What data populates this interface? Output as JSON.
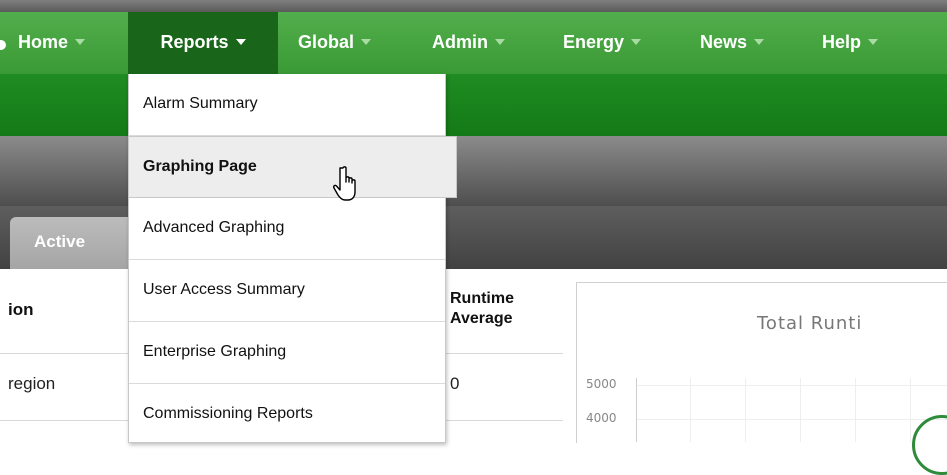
{
  "nav": {
    "items": [
      {
        "label": "Home"
      },
      {
        "label": "Reports"
      },
      {
        "label": "Global"
      },
      {
        "label": "Admin"
      },
      {
        "label": "Energy"
      },
      {
        "label": "News"
      },
      {
        "label": "Help"
      }
    ],
    "active": "Reports"
  },
  "reports_menu": {
    "items": [
      {
        "label": "Alarm Summary"
      },
      {
        "label": "Graphing Page",
        "hovered": true
      },
      {
        "label": "Advanced Graphing"
      },
      {
        "label": "User Access Summary"
      },
      {
        "label": "Enterprise Graphing"
      },
      {
        "label": "Commissioning Reports"
      }
    ]
  },
  "tabs": {
    "active_label": "Active"
  },
  "table": {
    "headers": {
      "col1": "ion",
      "runtime_line1": "Runtime",
      "runtime_line2": "Average"
    },
    "rows": [
      {
        "col1": "region",
        "runtime_average": "0"
      }
    ]
  },
  "chart": {
    "title": "Total Runti",
    "y_ticks": [
      "5000",
      "4000"
    ]
  },
  "colors": {
    "nav_green": "#4aa844",
    "nav_active": "#19661a",
    "subbar_green": "#1a841d"
  }
}
